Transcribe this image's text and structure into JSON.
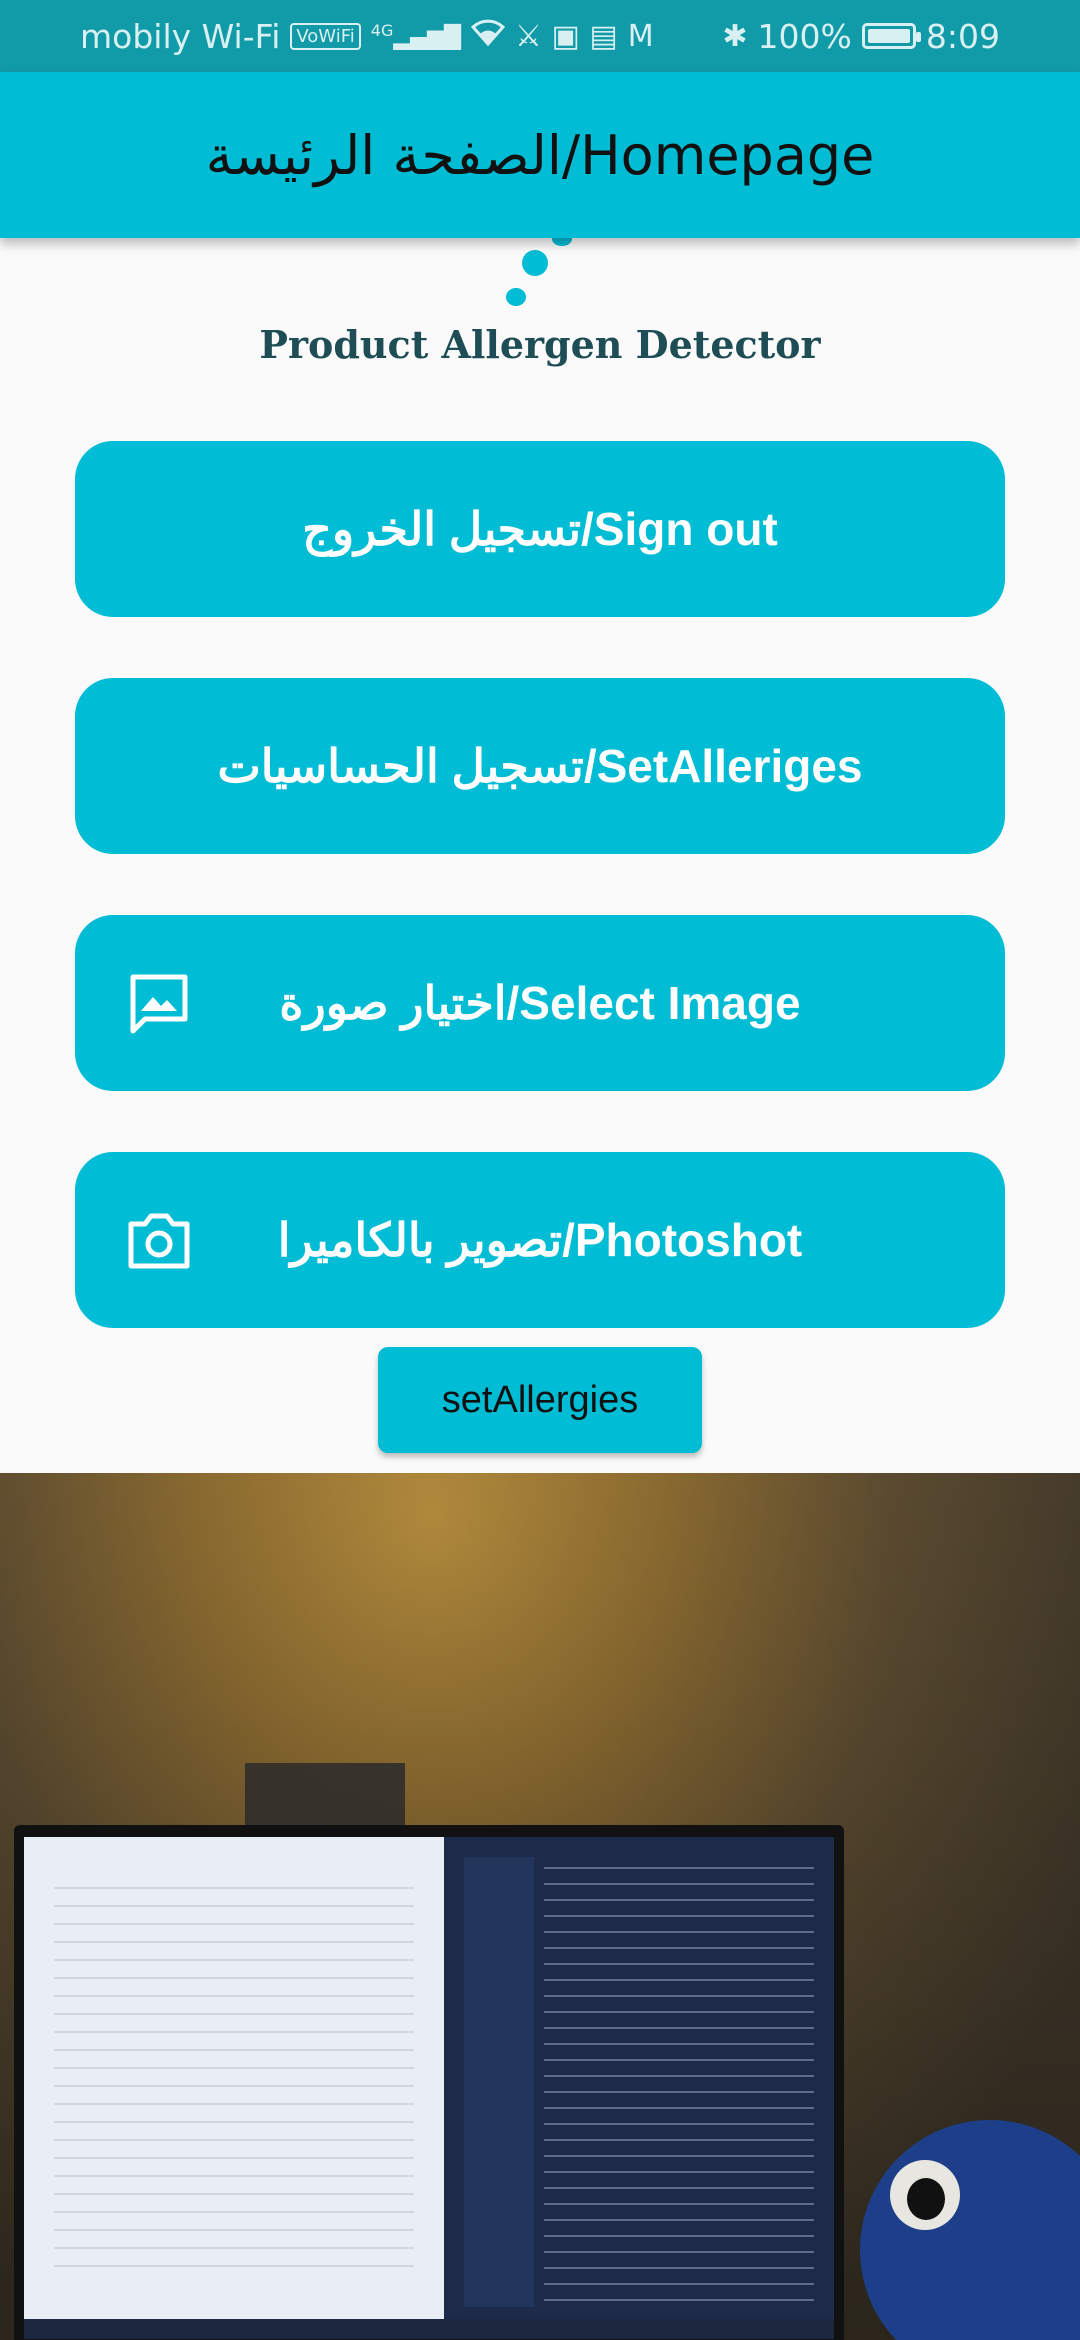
{
  "status_bar": {
    "carrier": "mobily Wi-Fi",
    "vowifi_badge": "VoWiFi",
    "network_type": "4G",
    "battery_percent": "100%",
    "battery_level": 1.0,
    "time": "8:09",
    "icons": [
      "vowifi-icon",
      "signal-icon",
      "wifi-icon",
      "notification-icons",
      "gmail-icon",
      "bluetooth-icon",
      "battery-icon"
    ]
  },
  "app_bar": {
    "title": "الصفحة الرئيسة/Homepage"
  },
  "subtitle": "Product Allergen Detector",
  "buttons": {
    "sign_out": "تسجيل الخروج/Sign out",
    "set_allergies": "تسجيل الحساسيات/SetAlleriges",
    "select_image": "اختيار صورة/Select Image",
    "photoshot": "تصوير بالكاميرا/Photoshot",
    "set_allergies_small": "setAllergies"
  },
  "colors": {
    "primary": "#00bcd4",
    "status_bar": "#119aa7",
    "subtitle": "#1f4d55",
    "background": "#fafafa"
  }
}
